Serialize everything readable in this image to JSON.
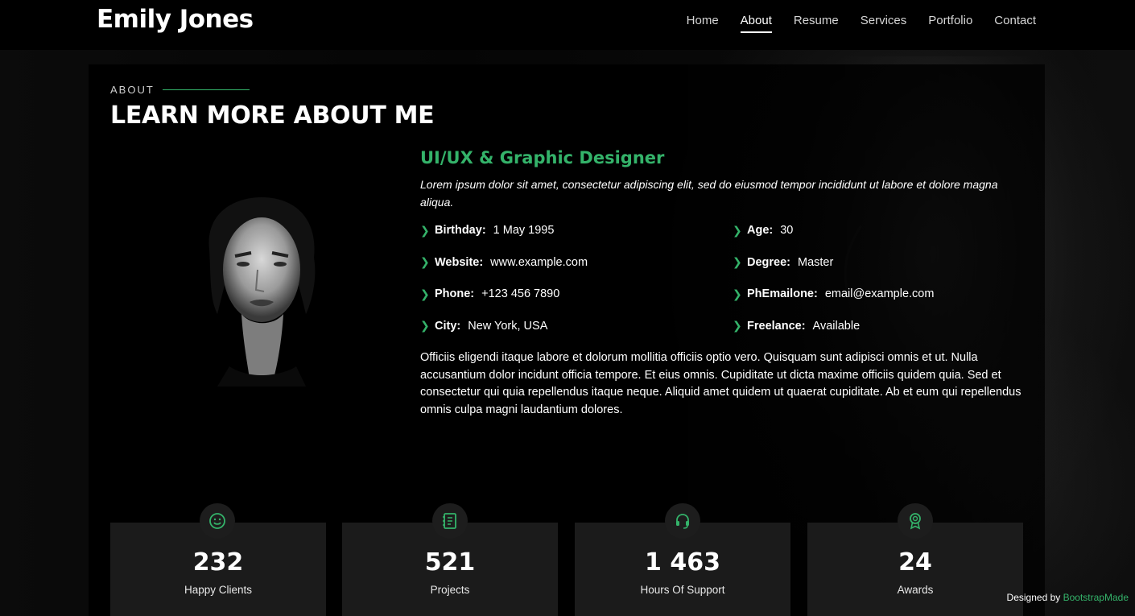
{
  "header": {
    "logo": "Emily Jones",
    "nav": [
      "Home",
      "About",
      "Resume",
      "Services",
      "Portfolio",
      "Contact"
    ],
    "active_nav": "About"
  },
  "about": {
    "kicker": "ABOUT",
    "title": "LEARN MORE ABOUT ME",
    "role": "UI/UX & Graphic Designer",
    "intro": "Lorem ipsum dolor sit amet, consectetur adipiscing elit, sed do eiusmod tempor incididunt ut labore et dolore magna aliqua.",
    "facts": [
      {
        "label": "Birthday:",
        "value": "1 May 1995"
      },
      {
        "label": "Age:",
        "value": "30"
      },
      {
        "label": "Website:",
        "value": "www.example.com"
      },
      {
        "label": "Degree:",
        "value": "Master"
      },
      {
        "label": "Phone:",
        "value": "+123 456 7890"
      },
      {
        "label": "PhEmailone:",
        "value": "email@example.com"
      },
      {
        "label": "City:",
        "value": "New York, USA"
      },
      {
        "label": "Freelance:",
        "value": "Available"
      }
    ],
    "body": "Officiis eligendi itaque labore et dolorum mollitia officiis optio vero. Quisquam sunt adipisci omnis et ut. Nulla accusantium dolor incidunt officia tempore. Et eius omnis. Cupiditate ut dicta maxime officiis quidem quia. Sed et consectetur qui quia repellendus itaque neque. Aliquid amet quidem ut quaerat cupiditate. Ab et eum qui repellendus omnis culpa magni laudantium dolores."
  },
  "stats": [
    {
      "value": "232",
      "label": "Happy Clients",
      "icon": "smiley-icon"
    },
    {
      "value": "521",
      "label": "Projects",
      "icon": "journal-icon"
    },
    {
      "value": "1 463",
      "label": "Hours Of Support",
      "icon": "headset-icon"
    },
    {
      "value": "24",
      "label": "Awards",
      "icon": "award-icon"
    }
  ],
  "footer": {
    "credit_prefix": "Designed by",
    "credit_link": "BootstrapMade"
  },
  "colors": {
    "accent": "#34b36a",
    "background": "#000000",
    "card": "#1b1b1b"
  }
}
